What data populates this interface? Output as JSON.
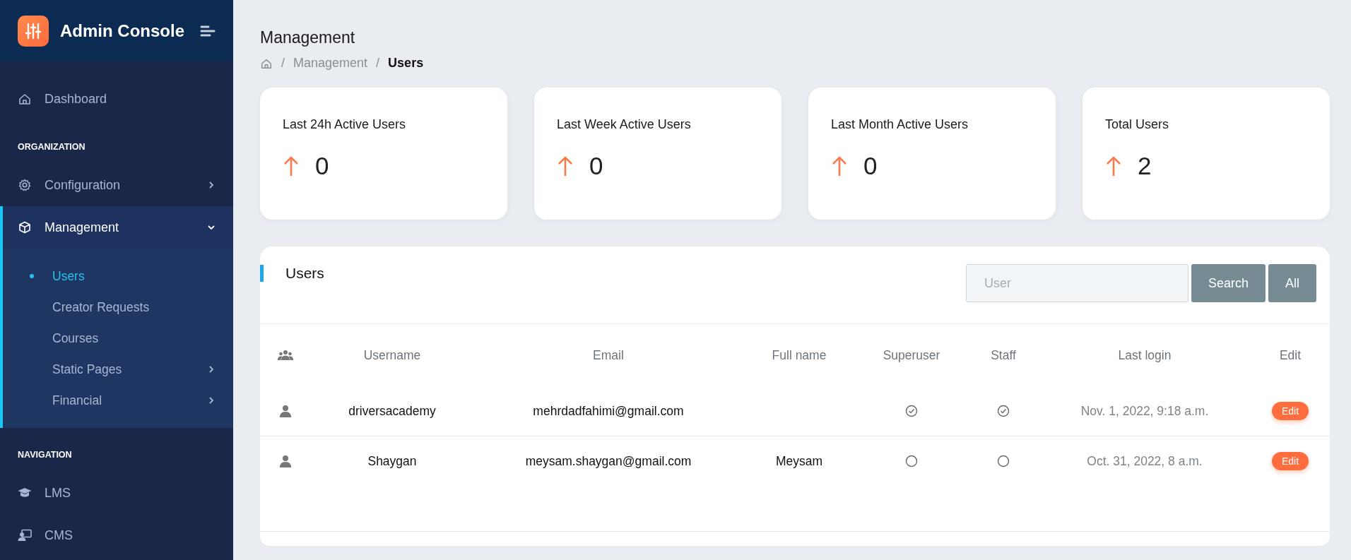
{
  "sidebar": {
    "brand": "Admin Console",
    "sections": [
      {
        "items": [
          {
            "kind": "link",
            "label": "Dashboard",
            "selected": false
          }
        ]
      },
      {
        "heading": "ORGANIZATION",
        "items": [
          {
            "kind": "group",
            "label": "Configuration",
            "selected": false,
            "expanded": false
          },
          {
            "kind": "group",
            "label": "Management",
            "selected": true,
            "expanded": true,
            "children": [
              {
                "kind": "link",
                "label": "Users",
                "selected": true
              },
              {
                "kind": "link",
                "label": "Creator Requests",
                "selected": false
              },
              {
                "kind": "link",
                "label": "Courses",
                "selected": false
              },
              {
                "kind": "group",
                "label": "Static Pages",
                "selected": false,
                "expanded": false
              },
              {
                "kind": "group",
                "label": "Financial",
                "selected": false,
                "expanded": false
              }
            ]
          }
        ]
      },
      {
        "heading": "NAVIGATION",
        "items": [
          {
            "kind": "link",
            "label": "LMS",
            "selected": false
          },
          {
            "kind": "link",
            "label": "CMS",
            "selected": false
          }
        ]
      }
    ]
  },
  "page": {
    "title": "Management",
    "breadcrumb": [
      {
        "separator": "/",
        "label": "Management"
      },
      {
        "separator": "/",
        "label": "Users"
      }
    ]
  },
  "stats": [
    {
      "label": "Last 24h Active Users",
      "value": "0"
    },
    {
      "label": "Last Week Active Users",
      "value": "0"
    },
    {
      "label": "Last Month Active Users",
      "value": "0"
    },
    {
      "label": "Total Users",
      "value": "2"
    }
  ],
  "users_panel": {
    "title": "Users",
    "search": {
      "placeholder": "User"
    },
    "buttons": [
      "Search",
      "All"
    ],
    "table": {
      "columns": [
        "Username",
        "Email",
        "Full name",
        "Superuser",
        "Staff",
        "Last login",
        "Edit"
      ],
      "rows": [
        {
          "username": "driversacademy",
          "email": "mehrdadfahimi@gmail.com",
          "superuser": true,
          "staff": true,
          "last_login": "Nov. 1, 2022, 9:18 a.m.",
          "edit": "Edit"
        },
        {
          "username": "Shaygan",
          "email": "meysam.shaygan@gmail.com",
          "full_name": "Meysam",
          "superuser": false,
          "staff": false,
          "last_login": "Oct. 31, 2022, 8 a.m.",
          "edit": "Edit"
        }
      ]
    }
  }
}
